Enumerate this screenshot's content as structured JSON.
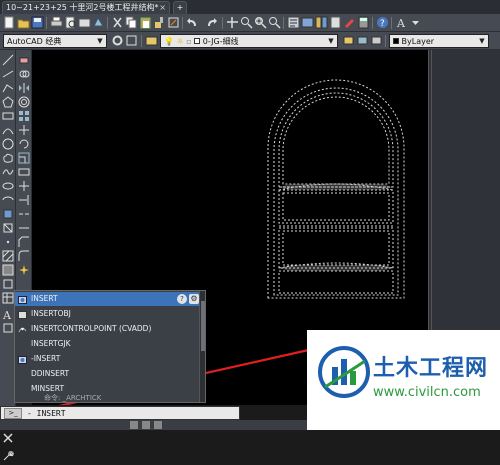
{
  "title_bar": {
    "tab_label": "10~21+23+25 十里河2号楼工程井结构*",
    "new_tab": "+"
  },
  "toolbar2": {
    "workspace": "AutoCAD 经典",
    "layer": "0-JG-細线",
    "color": "ByLayer"
  },
  "autocomplete": {
    "items": [
      {
        "label": "INSERT",
        "icon": "insert-block-icon",
        "selected": true
      },
      {
        "label": "INSERTOBJ",
        "icon": "insert-object-icon",
        "selected": false
      },
      {
        "label": "INSERTCONTROLPOINT (CVADD)",
        "icon": "control-point-icon",
        "selected": false
      },
      {
        "label": "INSERTGJK",
        "icon": "none",
        "selected": false
      },
      {
        "label": "-INSERT",
        "icon": "insert-block-icon",
        "selected": false
      },
      {
        "label": "DDINSERT",
        "icon": "none",
        "selected": false
      },
      {
        "label": "MINSERT",
        "icon": "none",
        "selected": false
      }
    ],
    "help_icon": "?",
    "settings_icon": "gear"
  },
  "history": {
    "line": "命令: _ARCHTICK"
  },
  "command_line": {
    "prompt": "- INSERT"
  },
  "watermark": {
    "title": "土木工程网",
    "url": "www.civilcn.com"
  },
  "colors": {
    "canvas": "#000000",
    "ui_gray": "#464a52",
    "selection": "#3d73b8",
    "arrow_red": "#e02020",
    "watermark_blue": "#1d5fae",
    "watermark_green": "#2a9a3e"
  }
}
